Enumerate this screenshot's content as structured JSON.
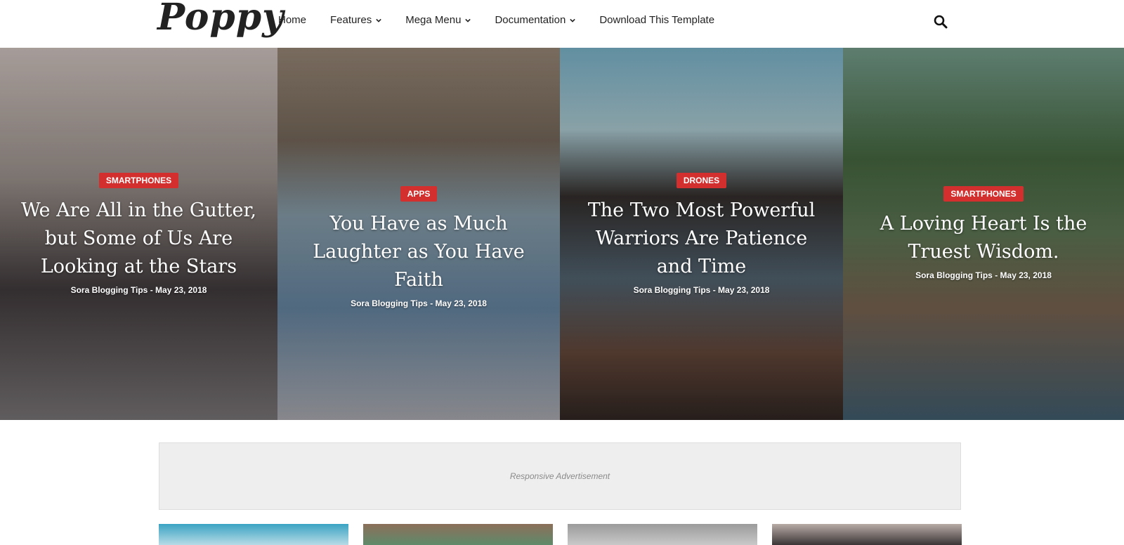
{
  "header": {
    "logo": "Poppy",
    "nav": [
      {
        "label": "Home",
        "dropdown": false
      },
      {
        "label": "Features",
        "dropdown": true
      },
      {
        "label": "Mega Menu",
        "dropdown": true
      },
      {
        "label": "Documentation",
        "dropdown": true
      },
      {
        "label": "Download This Template",
        "dropdown": false
      }
    ],
    "search_icon": "search-icon"
  },
  "slider": [
    {
      "category": "SMARTPHONES",
      "title": "We Are All in the Gutter, but Some of Us Are Looking at the Stars",
      "meta": "Sora Blogging Tips - May 23, 2018"
    },
    {
      "category": "APPS",
      "title": "You Have as Much Laughter as You Have Faith",
      "meta": "Sora Blogging Tips - May 23, 2018"
    },
    {
      "category": "DRONES",
      "title": "The Two Most Powerful Warriors Are Patience and Time",
      "meta": "Sora Blogging Tips - May 23, 2018"
    },
    {
      "category": "SMARTPHONES",
      "title": "A Loving Heart Is the Truest Wisdom.",
      "meta": "Sora Blogging Tips - May 23, 2018"
    }
  ],
  "ad": {
    "label": "Responsive Advertisement"
  },
  "colors": {
    "accent": "#d32f2f",
    "ad_bg": "#eeeeee"
  }
}
